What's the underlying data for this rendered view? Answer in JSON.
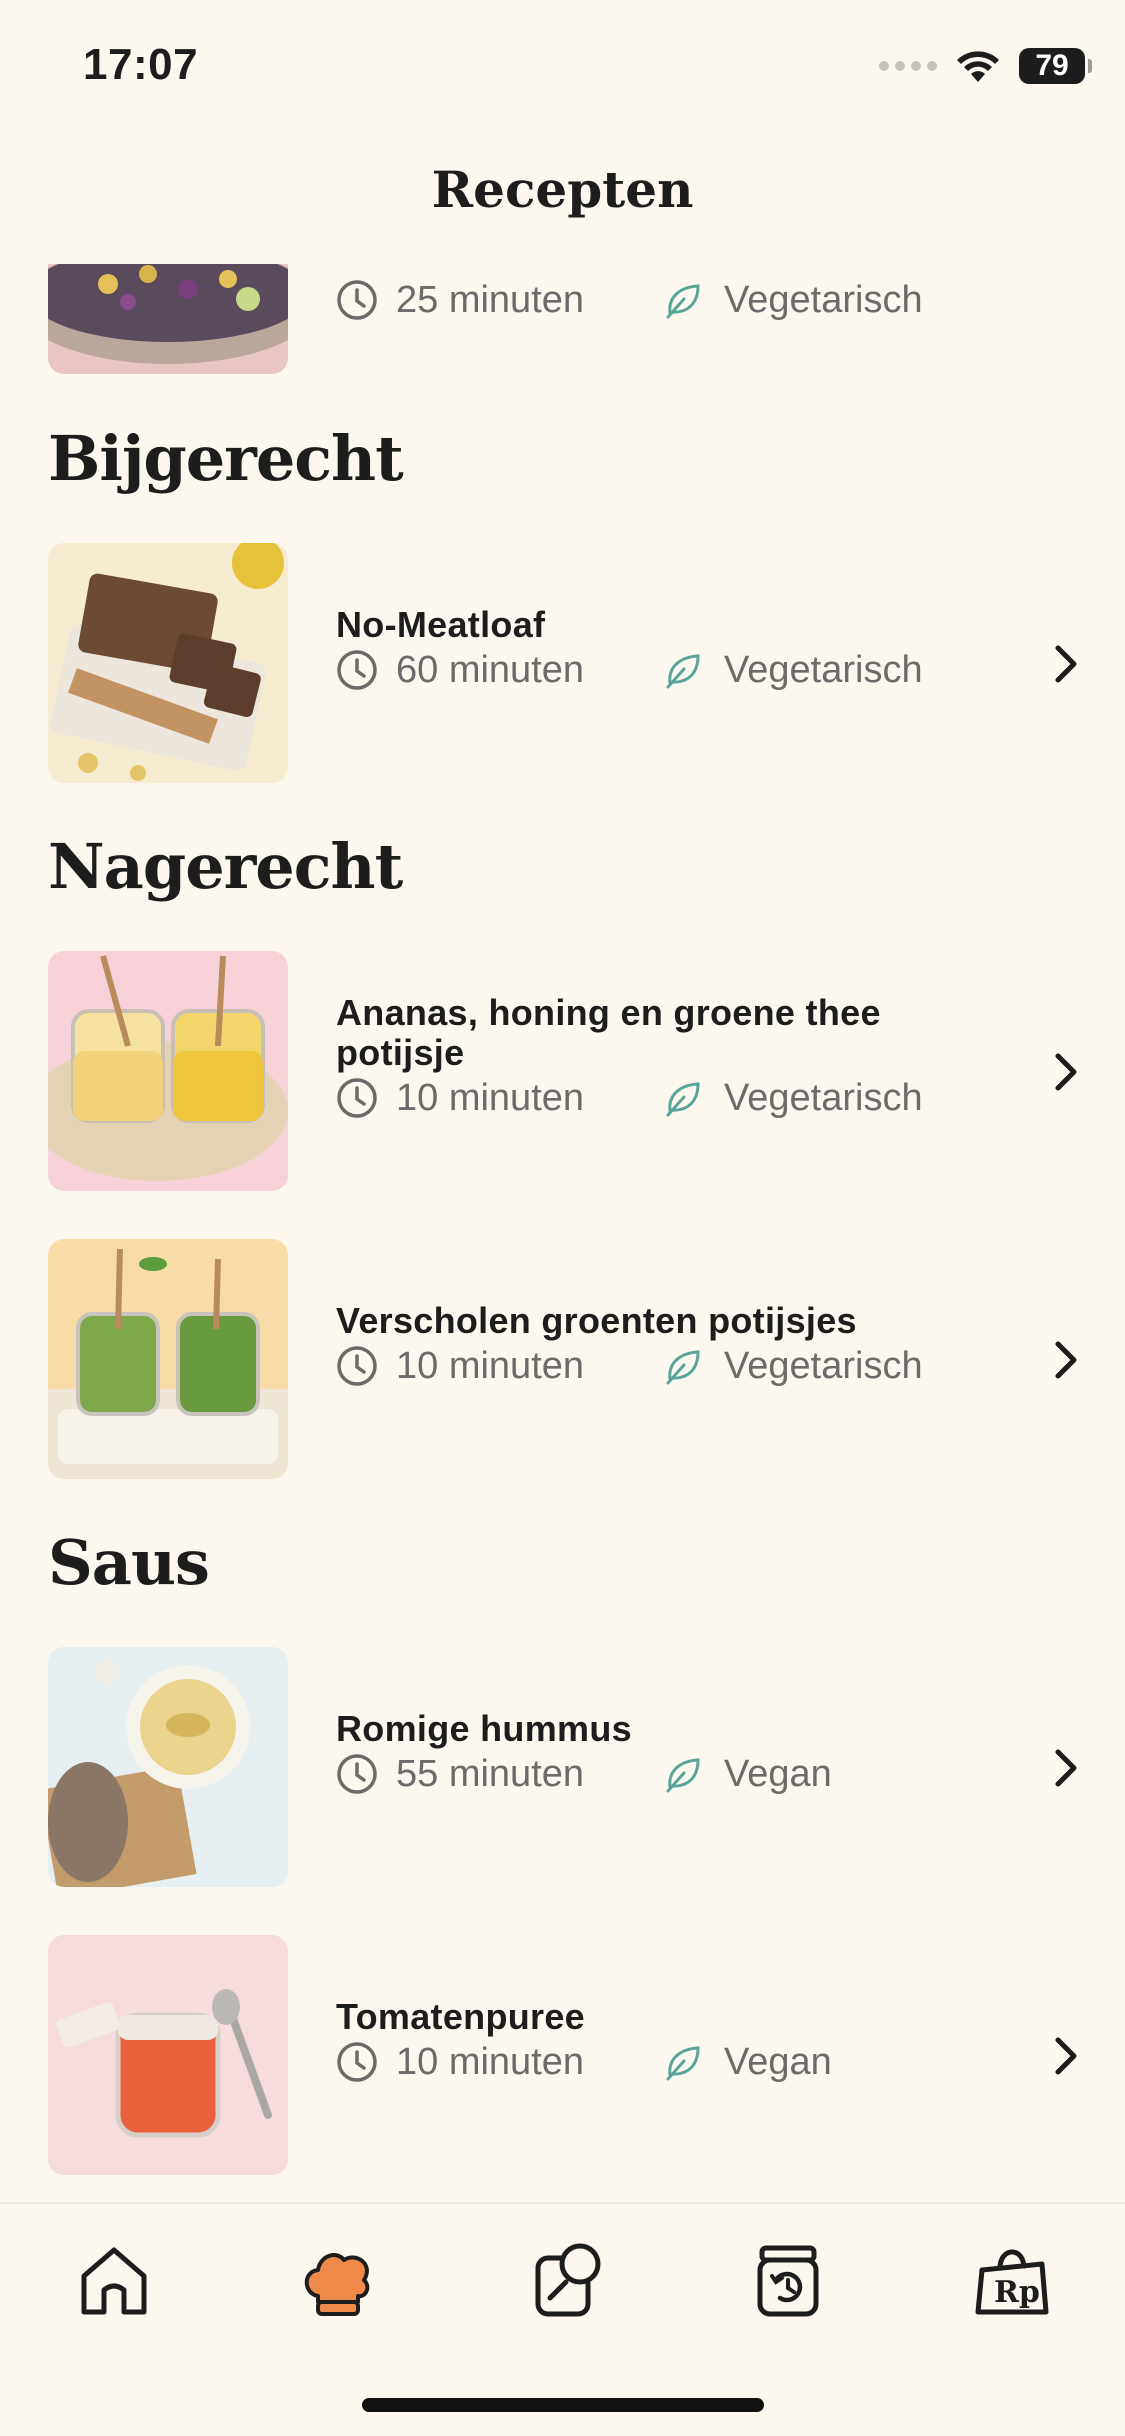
{
  "status_bar": {
    "time": "17:07",
    "battery": "79"
  },
  "header": {
    "title": "Recepten"
  },
  "sections": [
    {
      "title": "Bijgerecht"
    },
    {
      "title": "Nagerecht"
    },
    {
      "title": "Saus"
    }
  ],
  "recipes": [
    {
      "title": "",
      "time": "25 minuten",
      "diet": "Vegetarisch"
    },
    {
      "title": "No-Meatloaf",
      "time": "60 minuten",
      "diet": "Vegetarisch"
    },
    {
      "title": "Ananas, honing en groene thee potijsje",
      "time": "10 minuten",
      "diet": "Vegetarisch"
    },
    {
      "title": "Verscholen groenten potijsjes",
      "time": "10 minuten",
      "diet": "Vegetarisch"
    },
    {
      "title": "Romige hummus",
      "time": "55 minuten",
      "diet": "Vegan"
    },
    {
      "title": "Tomatenpuree",
      "time": "10 minuten",
      "diet": "Vegan"
    }
  ],
  "tab_bar": {
    "tabs": [
      {
        "icon": "home-icon",
        "active": false
      },
      {
        "icon": "chef-hat-icon",
        "active": true
      },
      {
        "icon": "food-jar-icon",
        "active": false
      },
      {
        "icon": "history-jar-icon",
        "active": false
      },
      {
        "icon": "shopping-bag-icon",
        "active": false
      }
    ]
  },
  "colors": {
    "background": "#fcf8ef",
    "accent": "#f08a4b",
    "leaf": "#5aa59a",
    "text": "#1d1d1d",
    "muted": "#6b6b6b"
  }
}
